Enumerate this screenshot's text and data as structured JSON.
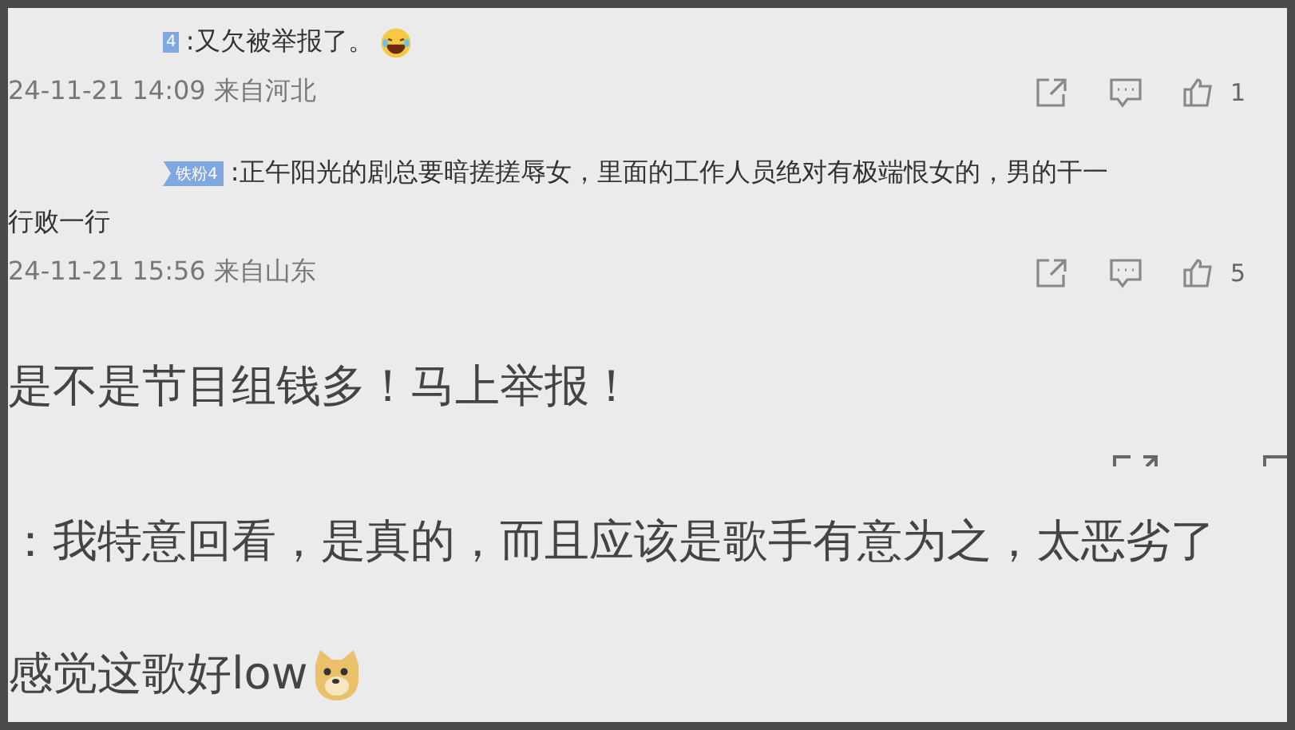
{
  "comments": [
    {
      "badge": {
        "text": "4",
        "kind": "stub"
      },
      "lines": [
        ":又欠被举报了。"
      ],
      "emoji": {
        "kind": "laughing"
      },
      "meta": "24-11-21 14:09 来自河北",
      "likes": "1"
    },
    {
      "badge": {
        "text": "铁粉4",
        "kind": "full"
      },
      "lines": [
        ":正午阳光的剧总要暗搓搓辱女，里面的工作人员绝对有极端恨女的，男的干一",
        "行败一行"
      ],
      "meta": "24-11-21 15:56 来自山东",
      "likes": "5"
    }
  ],
  "large_lines": [
    {
      "text": "是不是节目组钱多！马上举报！"
    },
    {
      "text": "：我特意回看，是真的，而且应该是歌手有意为之，太恶劣了"
    },
    {
      "text": "感觉这歌好low",
      "emoji": {
        "kind": "doge"
      }
    }
  ]
}
